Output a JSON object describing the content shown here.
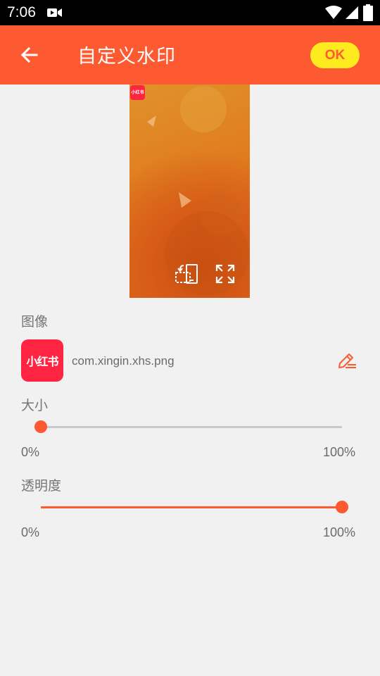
{
  "status_bar": {
    "time": "7:06",
    "icons": [
      "video-icon",
      "wifi-icon",
      "signal-icon",
      "battery-icon"
    ]
  },
  "app_bar": {
    "title": "自定义水印",
    "back_icon": "arrow-left-icon",
    "ok_label": "OK",
    "colors": {
      "bar": "#fd5a32",
      "ok_button": "#fdeb1f",
      "ok_text": "#fd5a32"
    }
  },
  "preview": {
    "watermark_logo_text": "小红书",
    "rotate_icon": "rotate-screen-icon",
    "fullscreen_icon": "fullscreen-icon"
  },
  "image_section": {
    "label": "图像",
    "thumbnail_text": "小红书",
    "filename": "com.xingin.xhs.png",
    "edit_icon": "edit-pencil-icon"
  },
  "size_section": {
    "label": "大小",
    "value_fraction": 0.0,
    "min_label": "0%",
    "max_label": "100%"
  },
  "opacity_section": {
    "label": "透明度",
    "value_fraction": 1.0,
    "min_label": "0%",
    "max_label": "100%"
  }
}
